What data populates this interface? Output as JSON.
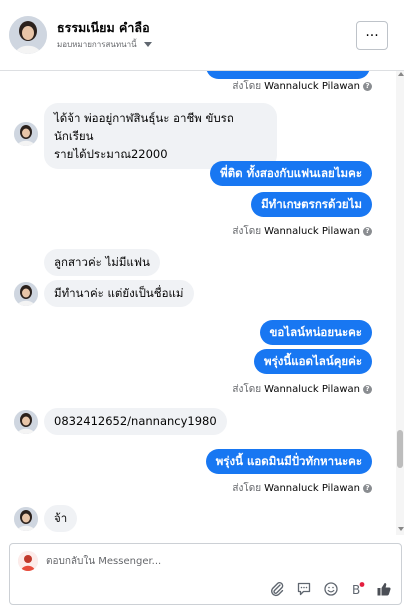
{
  "header": {
    "contact_name": "ธรรมเนียม คำลือ",
    "assign_label": "มอบหมายการสนทนานี้",
    "more_label": "···"
  },
  "sent_by": {
    "prefix": "ส่งโดย",
    "name": "Wannaluck Pilawan",
    "info": "?"
  },
  "messages": [
    {
      "side": "in",
      "lines": [
        "ได้จ้า  พ่ออยู่กาฬสินธุ์นะ  อาชีพ ขับรถนักเรียน",
        "รายได้ประมาณ22000"
      ]
    },
    {
      "side": "out",
      "text": "พี่ติด ทั้งสองกับแฟนเลยไมคะ"
    },
    {
      "side": "out",
      "text": "มีทำเกษตรกรด้วยไม"
    },
    {
      "side": "in",
      "text": "ลูกสาวค่ะ  ไม่มีแฟน"
    },
    {
      "side": "in",
      "text": "มีทำนาค่ะ แต่ยังเป็นชื่อแม่"
    },
    {
      "side": "out",
      "text": "ขอไลน์หน่อยนะคะ"
    },
    {
      "side": "out",
      "text": "พรุ่งนี้แอดไลน์คุยค่ะ"
    },
    {
      "side": "in",
      "text": "0832412652/nannancy1980"
    },
    {
      "side": "out",
      "text": "พรุ่งนี้ แอดมินมีปั่วทักหานะคะ"
    },
    {
      "side": "in",
      "text": "จ้า"
    }
  ],
  "composer": {
    "placeholder": "ตอบกลับใน Messenger..."
  },
  "tools": [
    "paperclip-icon",
    "speech-bubble-icon",
    "emoji-icon",
    "sticker-icon",
    "like-icon"
  ],
  "colors": {
    "outgoing_bubble": "#1877f2",
    "incoming_bubble": "#f0f2f5",
    "notification_dot": "#e41e3f"
  }
}
